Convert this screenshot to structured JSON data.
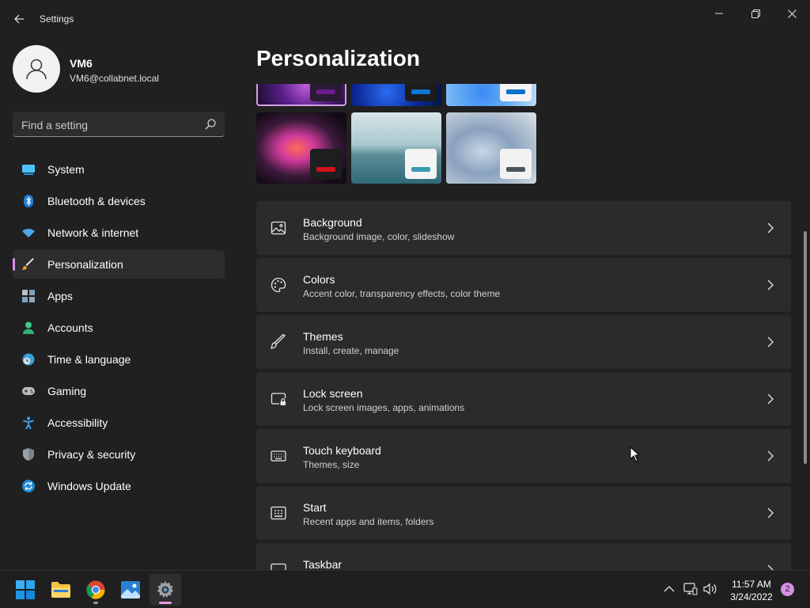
{
  "window": {
    "title": "Settings"
  },
  "profile": {
    "name": "VM6",
    "email": "VM6@collabnet.local"
  },
  "search": {
    "placeholder": "Find a setting"
  },
  "sidebar": {
    "items": [
      {
        "label": "System",
        "icon": "system-icon"
      },
      {
        "label": "Bluetooth & devices",
        "icon": "bluetooth-icon"
      },
      {
        "label": "Network & internet",
        "icon": "wifi-icon"
      },
      {
        "label": "Personalization",
        "icon": "brush-icon",
        "active": true
      },
      {
        "label": "Apps",
        "icon": "apps-icon"
      },
      {
        "label": "Accounts",
        "icon": "person-icon"
      },
      {
        "label": "Time & language",
        "icon": "clock-globe-icon"
      },
      {
        "label": "Gaming",
        "icon": "gamepad-icon"
      },
      {
        "label": "Accessibility",
        "icon": "accessibility-icon"
      },
      {
        "label": "Privacy & security",
        "icon": "shield-icon"
      },
      {
        "label": "Windows Update",
        "icon": "update-icon"
      }
    ]
  },
  "main": {
    "page_title": "Personalization",
    "themes": [
      {
        "name": "glow-theme",
        "accent": "#6a1e8c",
        "selected": true
      },
      {
        "name": "bloom-dark-theme",
        "accent": "#0a78d4"
      },
      {
        "name": "bloom-light-theme",
        "accent": "#0a6fc9"
      },
      {
        "name": "captured-motion-theme",
        "accent": "#d0101a"
      },
      {
        "name": "sunrise-lake-theme",
        "accent": "#3a9ab0"
      },
      {
        "name": "flow-theme",
        "accent": "#4a5560"
      }
    ],
    "settings": [
      {
        "title": "Background",
        "subtitle": "Background image, color, slideshow",
        "icon": "image-icon"
      },
      {
        "title": "Colors",
        "subtitle": "Accent color, transparency effects, color theme",
        "icon": "palette-icon"
      },
      {
        "title": "Themes",
        "subtitle": "Install, create, manage",
        "icon": "pen-icon"
      },
      {
        "title": "Lock screen",
        "subtitle": "Lock screen images, apps, animations",
        "icon": "lock-screen-icon"
      },
      {
        "title": "Touch keyboard",
        "subtitle": "Themes, size",
        "icon": "keyboard-icon"
      },
      {
        "title": "Start",
        "subtitle": "Recent apps and items, folders",
        "icon": "start-grid-icon"
      },
      {
        "title": "Taskbar",
        "subtitle": "",
        "icon": "taskbar-icon"
      }
    ]
  },
  "taskbar": {
    "apps": [
      {
        "name": "start",
        "icon": "windows-logo-icon"
      },
      {
        "name": "file-explorer",
        "icon": "folder-icon"
      },
      {
        "name": "chrome",
        "icon": "chrome-icon"
      },
      {
        "name": "photos",
        "icon": "photos-icon"
      },
      {
        "name": "settings",
        "icon": "gear-icon",
        "active": true
      }
    ],
    "time": "11:57 AM",
    "date": "3/24/2022",
    "notifications": "2"
  },
  "colors": {
    "accent": "#d98be6",
    "background": "#202020",
    "card": "#2b2b2b"
  }
}
